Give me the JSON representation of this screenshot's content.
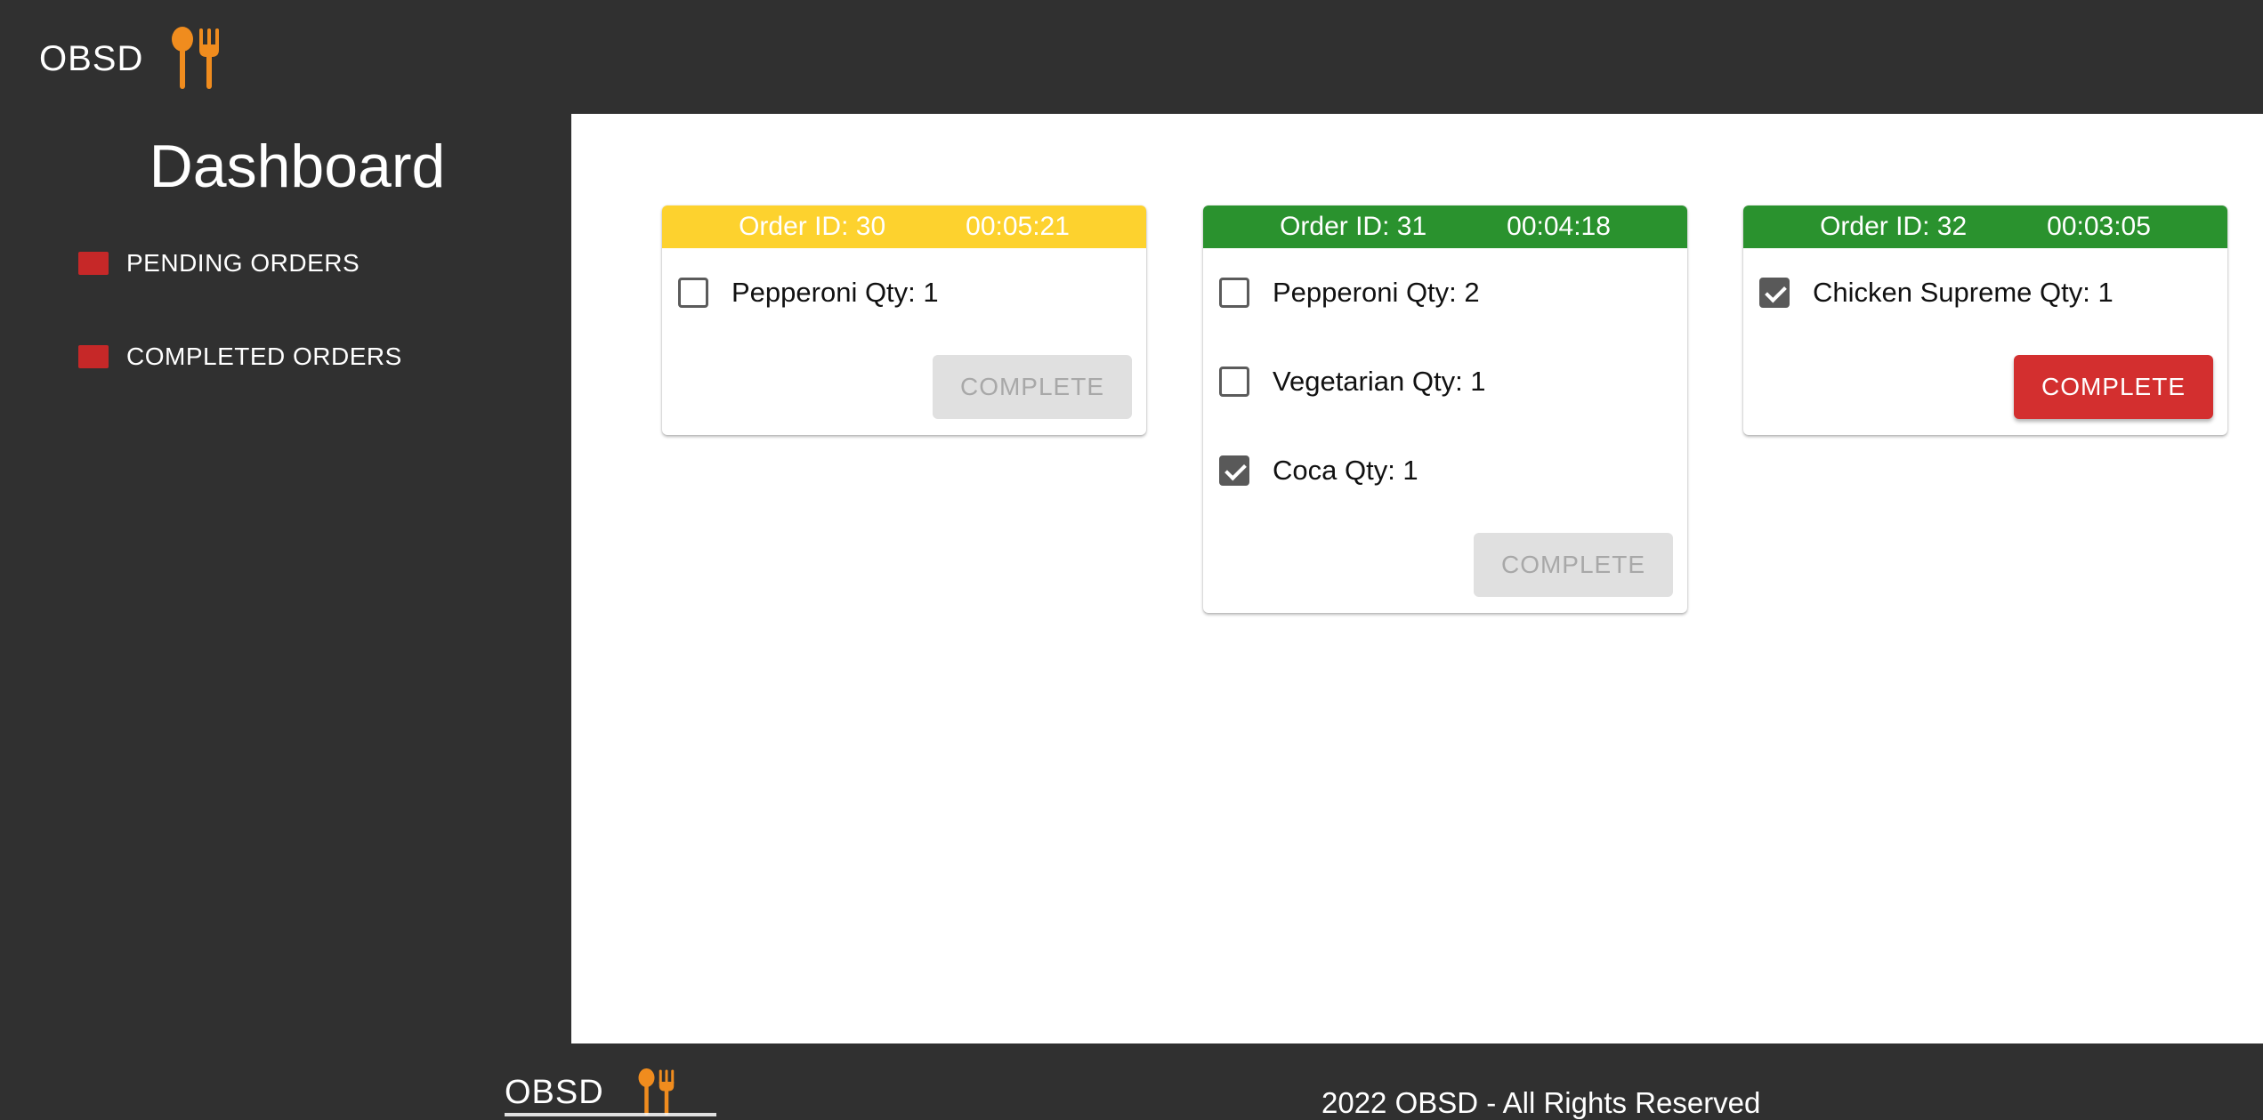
{
  "header": {
    "brand": "OBSD",
    "brand_icon": "cutlery-icon"
  },
  "sidebar": {
    "title": "Dashboard",
    "items": [
      {
        "label": "PENDING ORDERS",
        "color": "#c62828"
      },
      {
        "label": "COMPLETED ORDERS",
        "color": "#c62828"
      }
    ]
  },
  "orders": [
    {
      "id_label": "Order ID: 30",
      "timer": "00:05:21",
      "header_color": "#fdd22e",
      "items": [
        {
          "label": "Pepperoni Qty: 1",
          "checked": false
        }
      ],
      "button": {
        "label": "COMPLETE",
        "enabled": false
      }
    },
    {
      "id_label": "Order ID: 31",
      "timer": "00:04:18",
      "header_color": "#2a922e",
      "items": [
        {
          "label": "Pepperoni Qty: 2",
          "checked": false
        },
        {
          "label": "Vegetarian Qty: 1",
          "checked": false
        },
        {
          "label": "Coca Qty: 1",
          "checked": true
        }
      ],
      "button": {
        "label": "COMPLETE",
        "enabled": false
      }
    },
    {
      "id_label": "Order ID: 32",
      "timer": "00:03:05",
      "header_color": "#2a922e",
      "items": [
        {
          "label": "Chicken Supreme Qty: 1",
          "checked": true
        }
      ],
      "button": {
        "label": "COMPLETE",
        "enabled": true
      }
    }
  ],
  "footer": {
    "brand": "OBSD",
    "brand_icon": "cutlery-icon",
    "copyright": "2022 OBSD - All Rights Reserved"
  },
  "colors": {
    "background": "#303030",
    "accent_icon": "#f08c1e",
    "complete_button": "#d32f2f"
  }
}
